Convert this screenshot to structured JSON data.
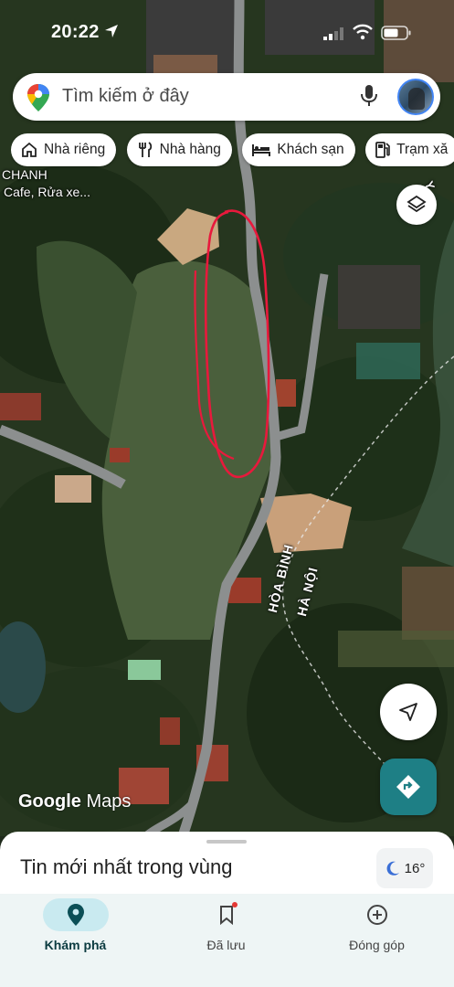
{
  "status_bar": {
    "time": "20:22"
  },
  "search": {
    "placeholder": "Tìm kiếm ở đây"
  },
  "chips": [
    {
      "label": "Nhà riêng",
      "icon": "home-icon"
    },
    {
      "label": "Nhà hàng",
      "icon": "restaurant-icon"
    },
    {
      "label": "Khách sạn",
      "icon": "hotel-icon"
    },
    {
      "label": "Trạm xă",
      "icon": "gas-station-icon"
    }
  ],
  "map": {
    "labels": {
      "place_line1": "CHANH",
      "place_line2": "Cafe, Rửa xe...",
      "border_left": "HÒA BÌNH",
      "border_right": "HÀ NỘI",
      "edge_top": "Y BÌNH"
    },
    "watermark_google": "Google",
    "watermark_maps": "Maps"
  },
  "sheet": {
    "title": "Tin mới nhất trong vùng",
    "weather": "16°"
  },
  "nav": [
    {
      "label": "Khám phá",
      "icon": "explore-pin-icon",
      "active": true
    },
    {
      "label": "Đã lưu",
      "icon": "bookmark-icon",
      "active": false
    },
    {
      "label": "Đóng góp",
      "icon": "add-circle-icon",
      "active": false
    }
  ],
  "colors": {
    "accent_teal": "#1e7f85",
    "annotation_red": "#e8193c",
    "nav_active_bg": "#c9eaf0"
  }
}
